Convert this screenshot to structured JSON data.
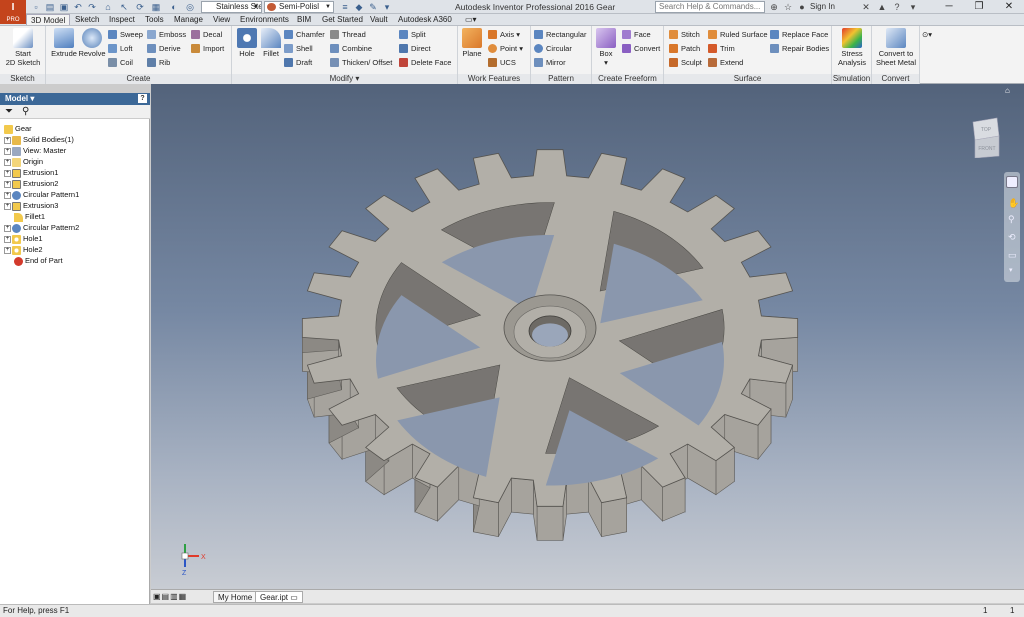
{
  "app": {
    "pro_label": "PRO",
    "title": "Autodesk Inventor Professional 2016   Gear",
    "help_placeholder": "Search Help & Commands...",
    "sign_in": "Sign In"
  },
  "qat": {
    "material": "Stainless Steel",
    "appearance": "Semi-Polisl"
  },
  "tabs": [
    "3D Model",
    "Sketch",
    "Inspect",
    "Tools",
    "Manage",
    "View",
    "Environments",
    "BIM",
    "Get Started",
    "Vault",
    "Autodesk A360"
  ],
  "ribbon": {
    "sketch": {
      "label": "Sketch",
      "start": "Start",
      "start2": "2D Sketch"
    },
    "create": {
      "label": "Create",
      "extrude": "Extrude",
      "revolve": "Revolve",
      "sweep": "Sweep",
      "loft": "Loft",
      "coil": "Coil",
      "emboss": "Emboss",
      "derive": "Derive",
      "rib": "Rib",
      "decal": "Decal",
      "import": "Import"
    },
    "modify": {
      "label": "Modify",
      "hole": "Hole",
      "fillet": "Fillet",
      "chamfer": "Chamfer",
      "shell": "Shell",
      "draft": "Draft",
      "thread": "Thread",
      "combine": "Combine",
      "thicken": "Thicken/ Offset",
      "split": "Split",
      "direct": "Direct",
      "delete_face": "Delete Face"
    },
    "work": {
      "label": "Work Features",
      "plane": "Plane",
      "axis": "Axis",
      "point": "Point",
      "ucs": "UCS"
    },
    "pattern": {
      "label": "Pattern",
      "rectangular": "Rectangular",
      "circular": "Circular",
      "mirror": "Mirror"
    },
    "freeform": {
      "label": "Create Freeform",
      "box": "Box",
      "face": "Face",
      "convert": "Convert"
    },
    "surface": {
      "label": "Surface",
      "stitch": "Stitch",
      "patch": "Patch",
      "sculpt": "Sculpt",
      "ruled_surface": "Ruled Surface",
      "trim": "Trim",
      "extend": "Extend",
      "replace_face": "Replace Face",
      "repair_bodies": "Repair Bodies"
    },
    "simulation": {
      "label": "Simulation",
      "stress": "Stress",
      "stress2": "Analysis"
    },
    "convert": {
      "label": "Convert",
      "convert_to": "Convert to",
      "sheet_metal": "Sheet Metal"
    }
  },
  "browser": {
    "title": "Model",
    "nodes": [
      "Gear",
      "Solid Bodies(1)",
      "View: Master",
      "Origin",
      "Extrusion1",
      "Extrusion2",
      "Circular Pattern1",
      "Extrusion3",
      "Fillet1",
      "Circular Pattern2",
      "Hole1",
      "Hole2",
      "End of Part"
    ]
  },
  "viewcube": {
    "top": "TOP",
    "front": "FRONT"
  },
  "triad": {
    "x": "X",
    "y": "Y",
    "z": "Z"
  },
  "doc_tabs": {
    "home": "My Home",
    "file": "Gear.ipt"
  },
  "status": {
    "help": "For Help, press F1",
    "count1": "1",
    "count2": "1"
  },
  "colors": {
    "accent": "#c4441c",
    "browser_header": "#3c6897",
    "part_face": "#b2afa8"
  }
}
